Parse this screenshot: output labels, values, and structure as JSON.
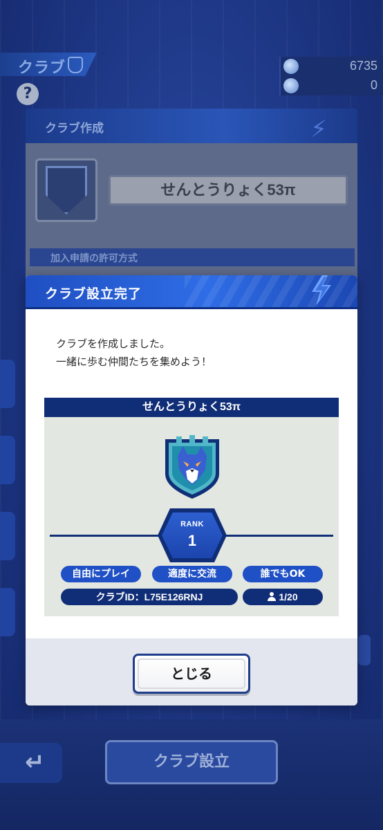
{
  "background": {
    "screen_title": "クラブ",
    "help_label": "?",
    "currencies": [
      {
        "icon": "gem-icon",
        "value": "6735"
      },
      {
        "icon": "gem-bonus-icon",
        "value": "0"
      }
    ],
    "create_button_label": "クラブ設立",
    "back_icon": "return-arrow-icon"
  },
  "create_dialog": {
    "title": "クラブ作成",
    "club_name": "せんとうりょく53π",
    "section_label": "加入申請の許可方式"
  },
  "complete_dialog": {
    "title": "クラブ設立完了",
    "message_lines": [
      "クラブを作成しました。",
      "一緒に歩む仲間たちを集めよう！"
    ],
    "card": {
      "club_name": "せんとうりょく53π",
      "emblem": "wolf-emblem-icon",
      "rank_label": "RANK",
      "rank_value": "1",
      "tags": [
        "自由にプレイ",
        "適度に交流",
        "誰でもOK"
      ],
      "club_id": "クラブID：L75E126RNJ",
      "members": "1/20"
    },
    "close_label": "とじる"
  },
  "colors": {
    "accent_blue": "#1f50c6",
    "navy": "#102e77",
    "card_bg": "#e3e7e1"
  }
}
